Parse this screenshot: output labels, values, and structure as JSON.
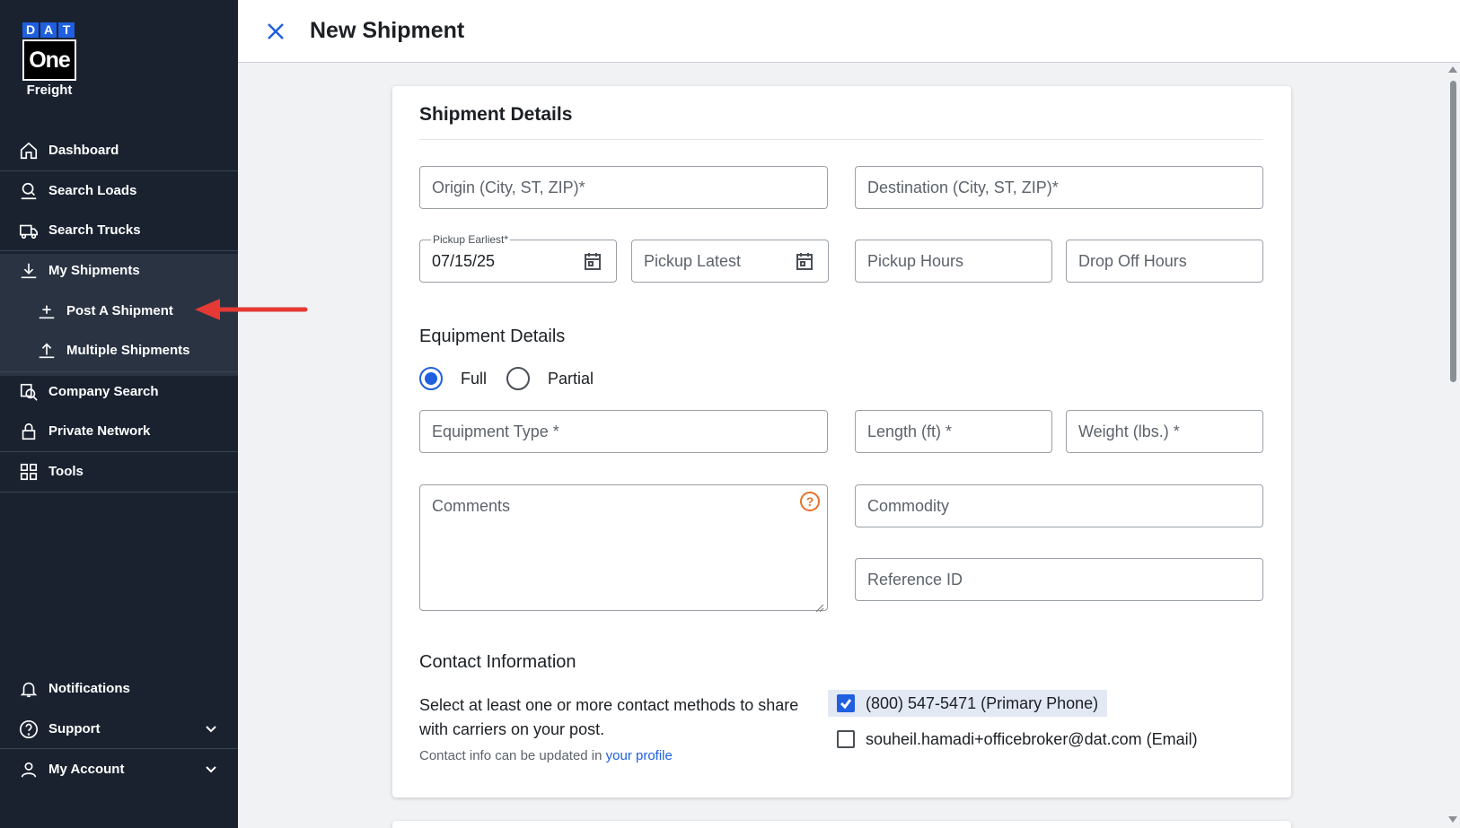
{
  "logo": {
    "letters": [
      "D",
      "A",
      "T"
    ],
    "one": "One",
    "freight": "Freight"
  },
  "sidebar": {
    "items": [
      {
        "label": "Dashboard",
        "icon": "home-icon"
      },
      {
        "label": "Search Loads",
        "icon": "search-loads-icon"
      },
      {
        "label": "Search Trucks",
        "icon": "truck-icon"
      },
      {
        "label": "My Shipments",
        "icon": "download-icon"
      },
      {
        "label": "Post A Shipment",
        "icon": "post-icon"
      },
      {
        "label": "Multiple Shipments",
        "icon": "upload-icon"
      },
      {
        "label": "Company Search",
        "icon": "company-search-icon"
      },
      {
        "label": "Private Network",
        "icon": "lock-icon"
      },
      {
        "label": "Tools",
        "icon": "grid-icon"
      }
    ],
    "bottom": [
      {
        "label": "Notifications",
        "icon": "bell-icon"
      },
      {
        "label": "Support",
        "icon": "help-circle-icon"
      },
      {
        "label": "My Account",
        "icon": "user-icon"
      }
    ]
  },
  "header": {
    "title": "New Shipment"
  },
  "shipment_details": {
    "title": "Shipment Details",
    "origin_placeholder": "Origin (City, ST, ZIP)*",
    "destination_placeholder": "Destination (City, ST, ZIP)*",
    "pickup_earliest_label": "Pickup Earliest*",
    "pickup_earliest_value": "07/15/25",
    "pickup_latest_placeholder": "Pickup Latest",
    "pickup_hours_placeholder": "Pickup Hours",
    "dropoff_hours_placeholder": "Drop Off Hours"
  },
  "equipment": {
    "title": "Equipment Details",
    "full_label": "Full",
    "partial_label": "Partial",
    "selected": "Full",
    "type_placeholder": "Equipment Type *",
    "length_placeholder": "Length (ft) *",
    "weight_placeholder": "Weight (lbs.) *",
    "comments_placeholder": "Comments",
    "commodity_placeholder": "Commodity",
    "reference_placeholder": "Reference ID"
  },
  "contact": {
    "title": "Contact Information",
    "description": "Select at least one or more contact methods to share with carriers on your post.",
    "note_prefix": "Contact info can be updated in ",
    "note_link": "your profile",
    "phone_label": "(800) 547-5471 (Primary Phone)",
    "phone_checked": true,
    "email_label": "souheil.hamadi+officebroker@dat.com (Email)",
    "email_checked": false
  },
  "colors": {
    "accent": "#1f5fe0",
    "sidebar_bg": "#1a2230",
    "annotation": "#e53935",
    "help": "#e8702a"
  }
}
